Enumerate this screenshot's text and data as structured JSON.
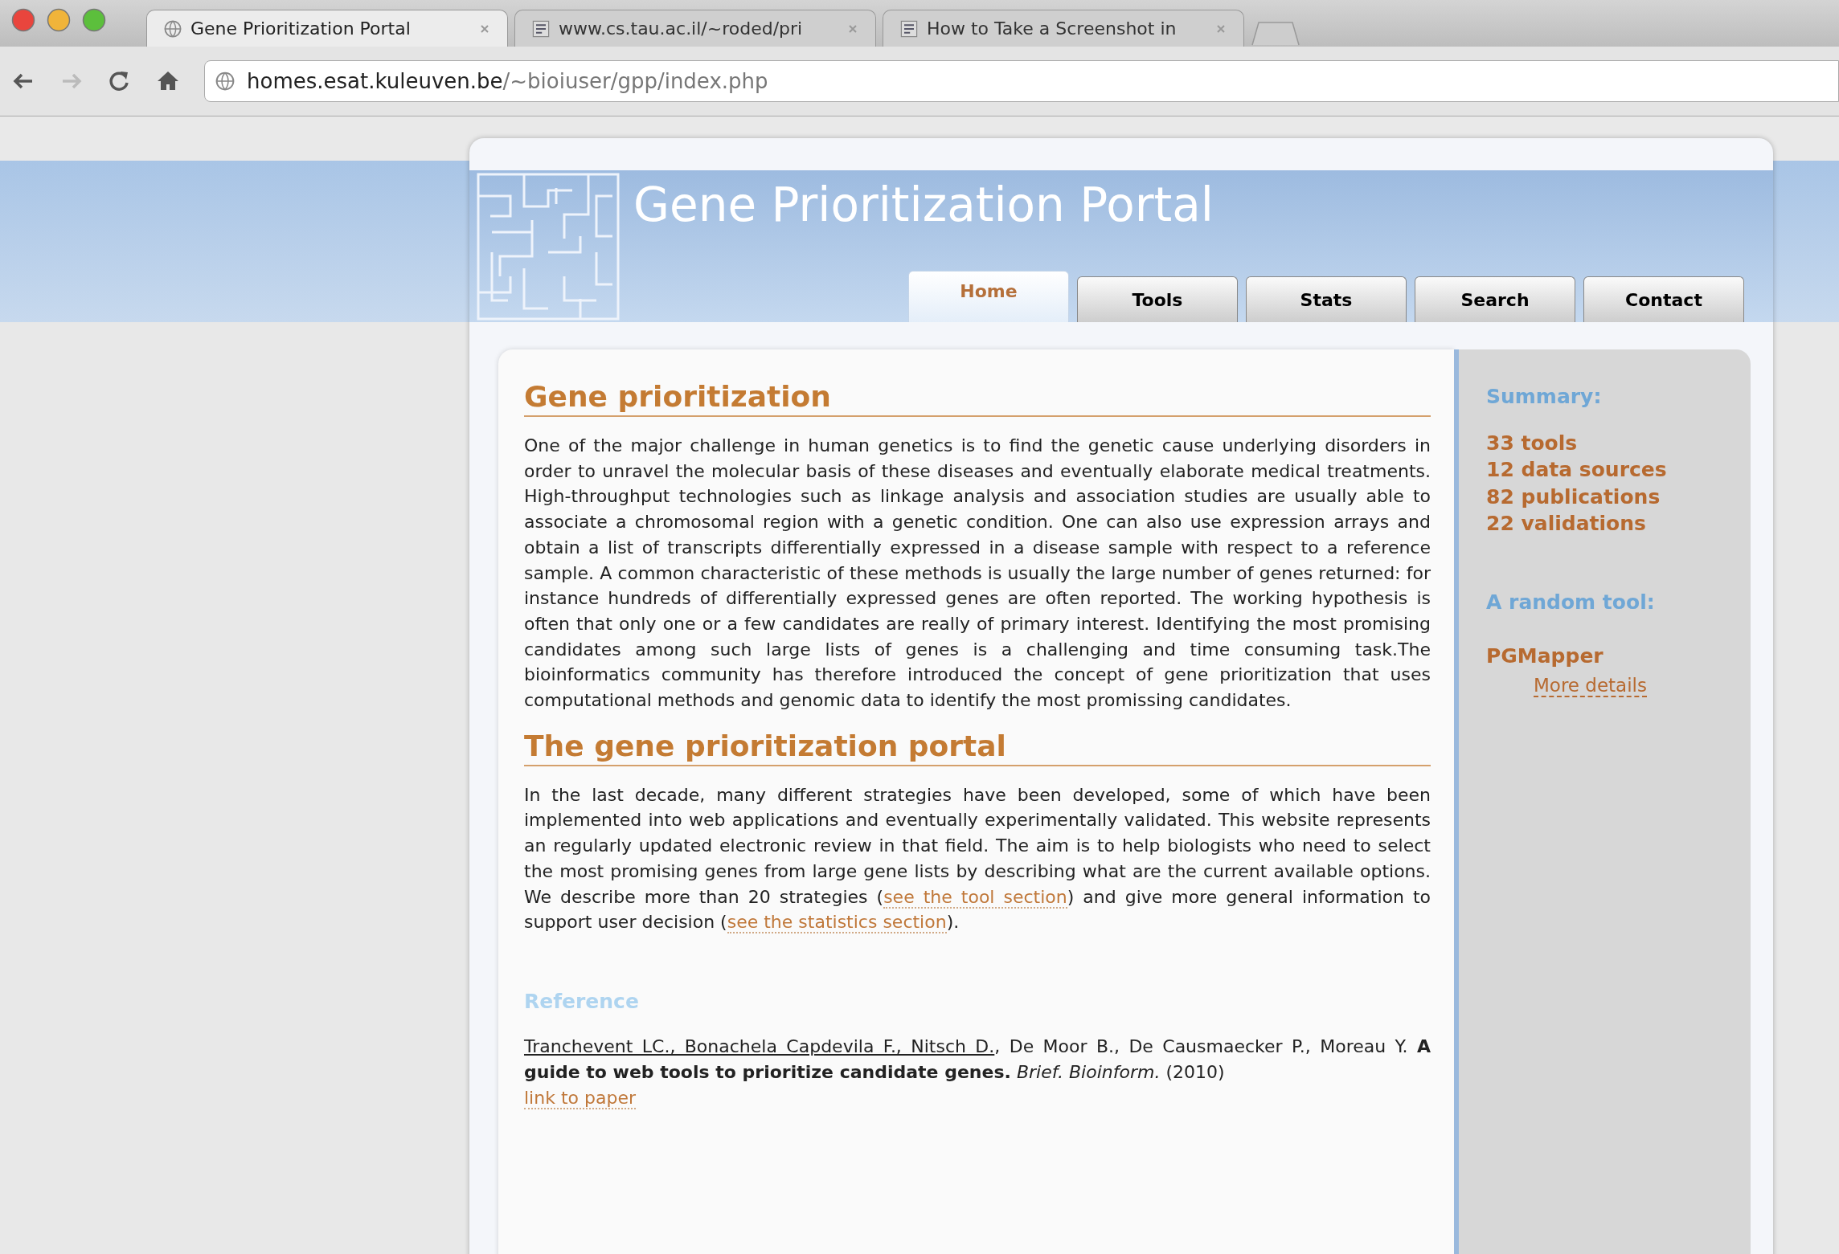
{
  "browser": {
    "tabs": [
      {
        "title": "Gene Prioritization Portal",
        "selected": true
      },
      {
        "title": "www.cs.tau.ac.il/~roded/pri",
        "selected": false
      },
      {
        "title": "How to Take a Screenshot in",
        "selected": false
      }
    ],
    "address": {
      "host": "homes.esat.kuleuven.be",
      "path": "/~bioiuser/gpp/index.php"
    }
  },
  "site": {
    "title": "Gene Prioritization Portal",
    "nav": [
      {
        "label": "Home",
        "selected": true
      },
      {
        "label": "Tools",
        "selected": false
      },
      {
        "label": "Stats",
        "selected": false
      },
      {
        "label": "Search",
        "selected": false
      },
      {
        "label": "Contact",
        "selected": false
      }
    ]
  },
  "sections": [
    {
      "heading": "Gene prioritization",
      "parts": [
        {
          "kind": "text",
          "text": "One of the major challenge in human genetics is to find the genetic cause underlying disorders in order to unravel the molecular basis of these diseases and eventually elaborate medical treatments. High-throughput technologies such as linkage analysis and association studies are usually able to associate a chromosomal region with a genetic condition. One can also use expression arrays and obtain a list of transcripts differentially expressed in a disease sample with respect to a reference sample. A common characteristic of these methods is usually the large number of genes returned: for instance hundreds of differentially expressed genes are often reported. The working hypothesis is often that only one or a few candidates are really of primary interest. Identifying the most promising candidates among such large lists of genes is a challenging and time consuming task.The bioinformatics community has therefore introduced the concept of gene prioritization that uses computational methods and genomic data to identify the most promissing candidates."
        }
      ]
    },
    {
      "heading": "The gene prioritization portal",
      "parts": [
        {
          "kind": "text",
          "text": "In the last decade, many different strategies have been developed, some of which have been implemented into web applications and eventually experimentally validated. This website represents an regularly updated electronic review in that field. The aim is to help biologists who need to select the most promising genes from large gene lists by describing what are the current available options. We describe more than 20 strategies ("
        },
        {
          "kind": "link",
          "text": "see the tool section"
        },
        {
          "kind": "text",
          "text": ") and give more general information to support user decision ("
        },
        {
          "kind": "link",
          "text": "see the statistics section"
        },
        {
          "kind": "text",
          "text": ")."
        }
      ]
    }
  ],
  "reference": {
    "heading": "Reference",
    "parts": [
      {
        "kind": "author_link",
        "text": "Tranchevent LC., Bonachela Capdevila F., Nitsch D."
      },
      {
        "kind": "text",
        "text": ", De Moor B., De Causmaecker P., Moreau Y. **A guide to web tools to prioritize candidate genes.** *Brief. Bioinform.* (2010)"
      }
    ],
    "link": "link to paper"
  },
  "sidebar": {
    "summary_heading": "Summary:",
    "stats": [
      "33 tools",
      "12 data sources",
      "82 publications",
      "22 validations"
    ],
    "random_heading": "A random tool:",
    "tool": "PGMapper",
    "details_link": "More details"
  }
}
